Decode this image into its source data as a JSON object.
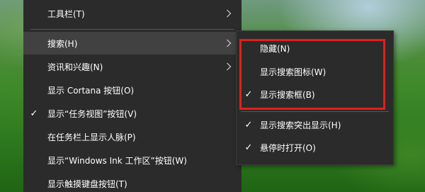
{
  "colors": {
    "menu_bg": "#2b2b2b",
    "menu_highlight": "#414141",
    "text": "#ffffff",
    "annotation": "#e0201a"
  },
  "main_menu": {
    "items": [
      {
        "label": "工具栏(T)",
        "checked": false,
        "has_submenu": true
      },
      {
        "label": "搜索(H)",
        "checked": false,
        "has_submenu": true,
        "highlighted": true
      },
      {
        "label": "资讯和兴趣(N)",
        "checked": false,
        "has_submenu": true
      },
      {
        "label": "显示 Cortana 按钮(O)",
        "checked": false,
        "has_submenu": false
      },
      {
        "label": "显示“任务视图”按钮(V)",
        "checked": true,
        "has_submenu": false
      },
      {
        "label": "在任务栏上显示人脉(P)",
        "checked": false,
        "has_submenu": false
      },
      {
        "label": "显示“Windows Ink 工作区”按钮(W)",
        "checked": false,
        "has_submenu": false
      },
      {
        "label": "显示触摸键盘按钮(T)",
        "checked": false,
        "has_submenu": false
      }
    ],
    "check_glyph": "✓",
    "chevron_icon": "chevron-right-icon"
  },
  "search_submenu": {
    "items": [
      {
        "label": "隐藏(N)",
        "checked": false
      },
      {
        "label": "显示搜索图标(W)",
        "checked": false
      },
      {
        "label": "显示搜索框(B)",
        "checked": true
      },
      {
        "label": "显示搜索突出显示(H)",
        "checked": true
      },
      {
        "label": "悬停时打开(O)",
        "checked": true
      }
    ]
  }
}
